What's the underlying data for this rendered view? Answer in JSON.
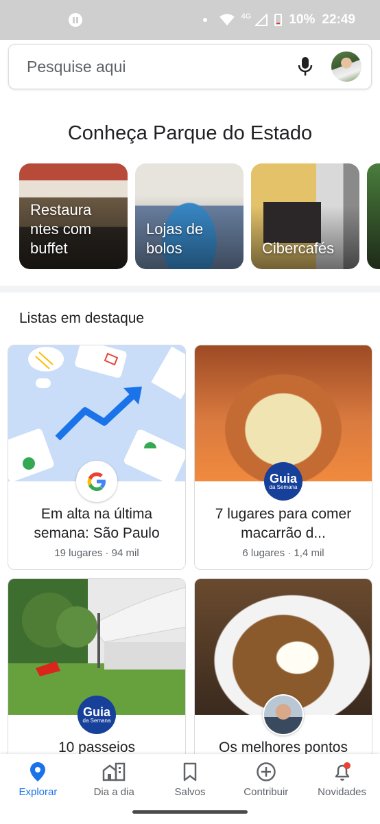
{
  "status_bar": {
    "network_badge": "4G",
    "battery": "10%",
    "time": "22:49"
  },
  "search": {
    "placeholder": "Pesquise aqui"
  },
  "explore": {
    "title": "Conheça Parque do Estado",
    "categories": [
      {
        "label": "Restaura ntes com buffet"
      },
      {
        "label": "Lojas de bolos"
      },
      {
        "label": "Cibercafés"
      }
    ]
  },
  "lists": {
    "title": "Listas em destaque",
    "cards": [
      {
        "title": "Em alta na última semana: São Paulo",
        "meta": "19 lugares · 94 mil"
      },
      {
        "title": "7 lugares para comer macarrão d...",
        "meta": "6 lugares · 1,4 mil"
      },
      {
        "title": "10 passeios",
        "meta": ""
      },
      {
        "title": "Os melhores pontos",
        "meta": ""
      }
    ],
    "guia_logo": {
      "big": "Guia",
      "small": "da Semana"
    }
  },
  "bottom_nav": {
    "items": [
      {
        "label": "Explorar",
        "icon": "location-pin-icon"
      },
      {
        "label": "Dia a dia",
        "icon": "city-icon"
      },
      {
        "label": "Salvos",
        "icon": "bookmark-icon"
      },
      {
        "label": "Contribuir",
        "icon": "add-circle-icon"
      },
      {
        "label": "Novidades",
        "icon": "bell-icon"
      }
    ]
  },
  "colors": {
    "accent": "#1a73e8",
    "status_bar": "#cfcfcf",
    "notification_dot": "#ea4335",
    "guia_blue": "#17409a"
  }
}
